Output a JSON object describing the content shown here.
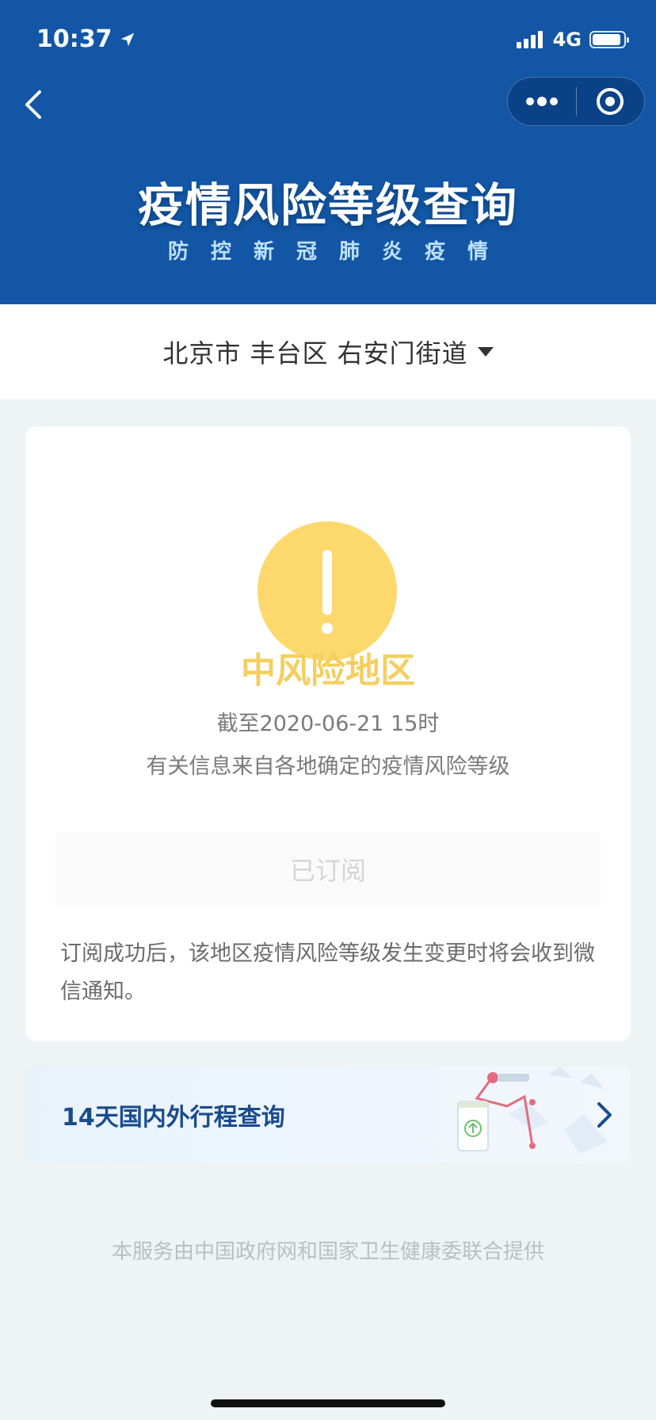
{
  "status_bar": {
    "time": "10:37",
    "network": "4G"
  },
  "header": {
    "title": "疫情风险等级查询",
    "subtitle": "防控新冠肺炎疫情"
  },
  "location": {
    "text": "北京市 丰台区 右安门街道"
  },
  "risk_card": {
    "level": "中风险地区",
    "as_of": "截至2020-06-21 15时",
    "source": "有关信息来自各地确定的疫情风险等级",
    "subscribe_label": "已订阅",
    "note": "订阅成功后，该地区疫情风险等级发生变更时将会收到微信通知。"
  },
  "travel": {
    "title": "14天国内外行程查询"
  },
  "footer": {
    "text": "本服务由中国政府网和国家卫生健康委联合提供"
  },
  "colors": {
    "header_bg": "#1256a5",
    "warning_yellow": "#fcd86d",
    "risk_text": "#f4cf5e",
    "travel_title": "#1a4c8c"
  },
  "icons": [
    "location-arrow-icon",
    "signal-icon",
    "battery-icon",
    "back-chevron-icon",
    "more-dots-icon",
    "close-target-icon",
    "dropdown-triangle-icon",
    "warning-exclamation-icon",
    "chevron-right-icon"
  ]
}
